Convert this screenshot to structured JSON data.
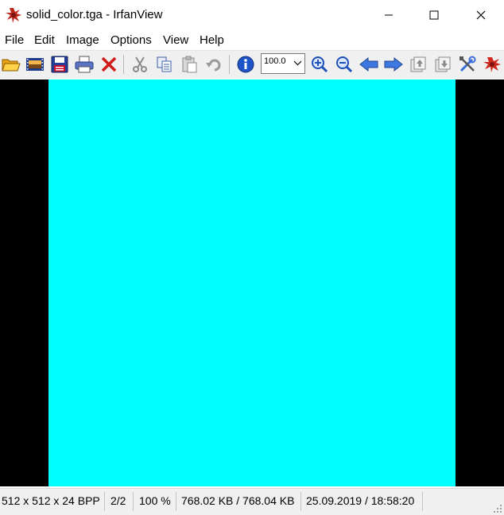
{
  "window": {
    "title": "solid_color.tga - IrfanView"
  },
  "menu": [
    "File",
    "Edit",
    "Image",
    "Options",
    "View",
    "Help"
  ],
  "toolbar": {
    "zoom_value": "100.0",
    "buttons": [
      "open-icon",
      "slideshow-icon",
      "save-icon",
      "print-icon",
      "delete-icon",
      "cut-icon",
      "copy-icon",
      "paste-icon",
      "undo-icon",
      "info-icon",
      "zoom-in-icon",
      "zoom-out-icon",
      "previous-icon",
      "next-icon",
      "first-icon",
      "last-icon",
      "properties-icon",
      "irfanview-logo-icon"
    ]
  },
  "image": {
    "fill_color": "#00ffff",
    "background_color": "#000000"
  },
  "status": {
    "dimensions": "512 x 512 x 24 BPP",
    "index": "2/2",
    "zoom": "100 %",
    "size": "768.02 KB / 768.04 KB",
    "datetime": "25.09.2019 / 18:58:20"
  }
}
